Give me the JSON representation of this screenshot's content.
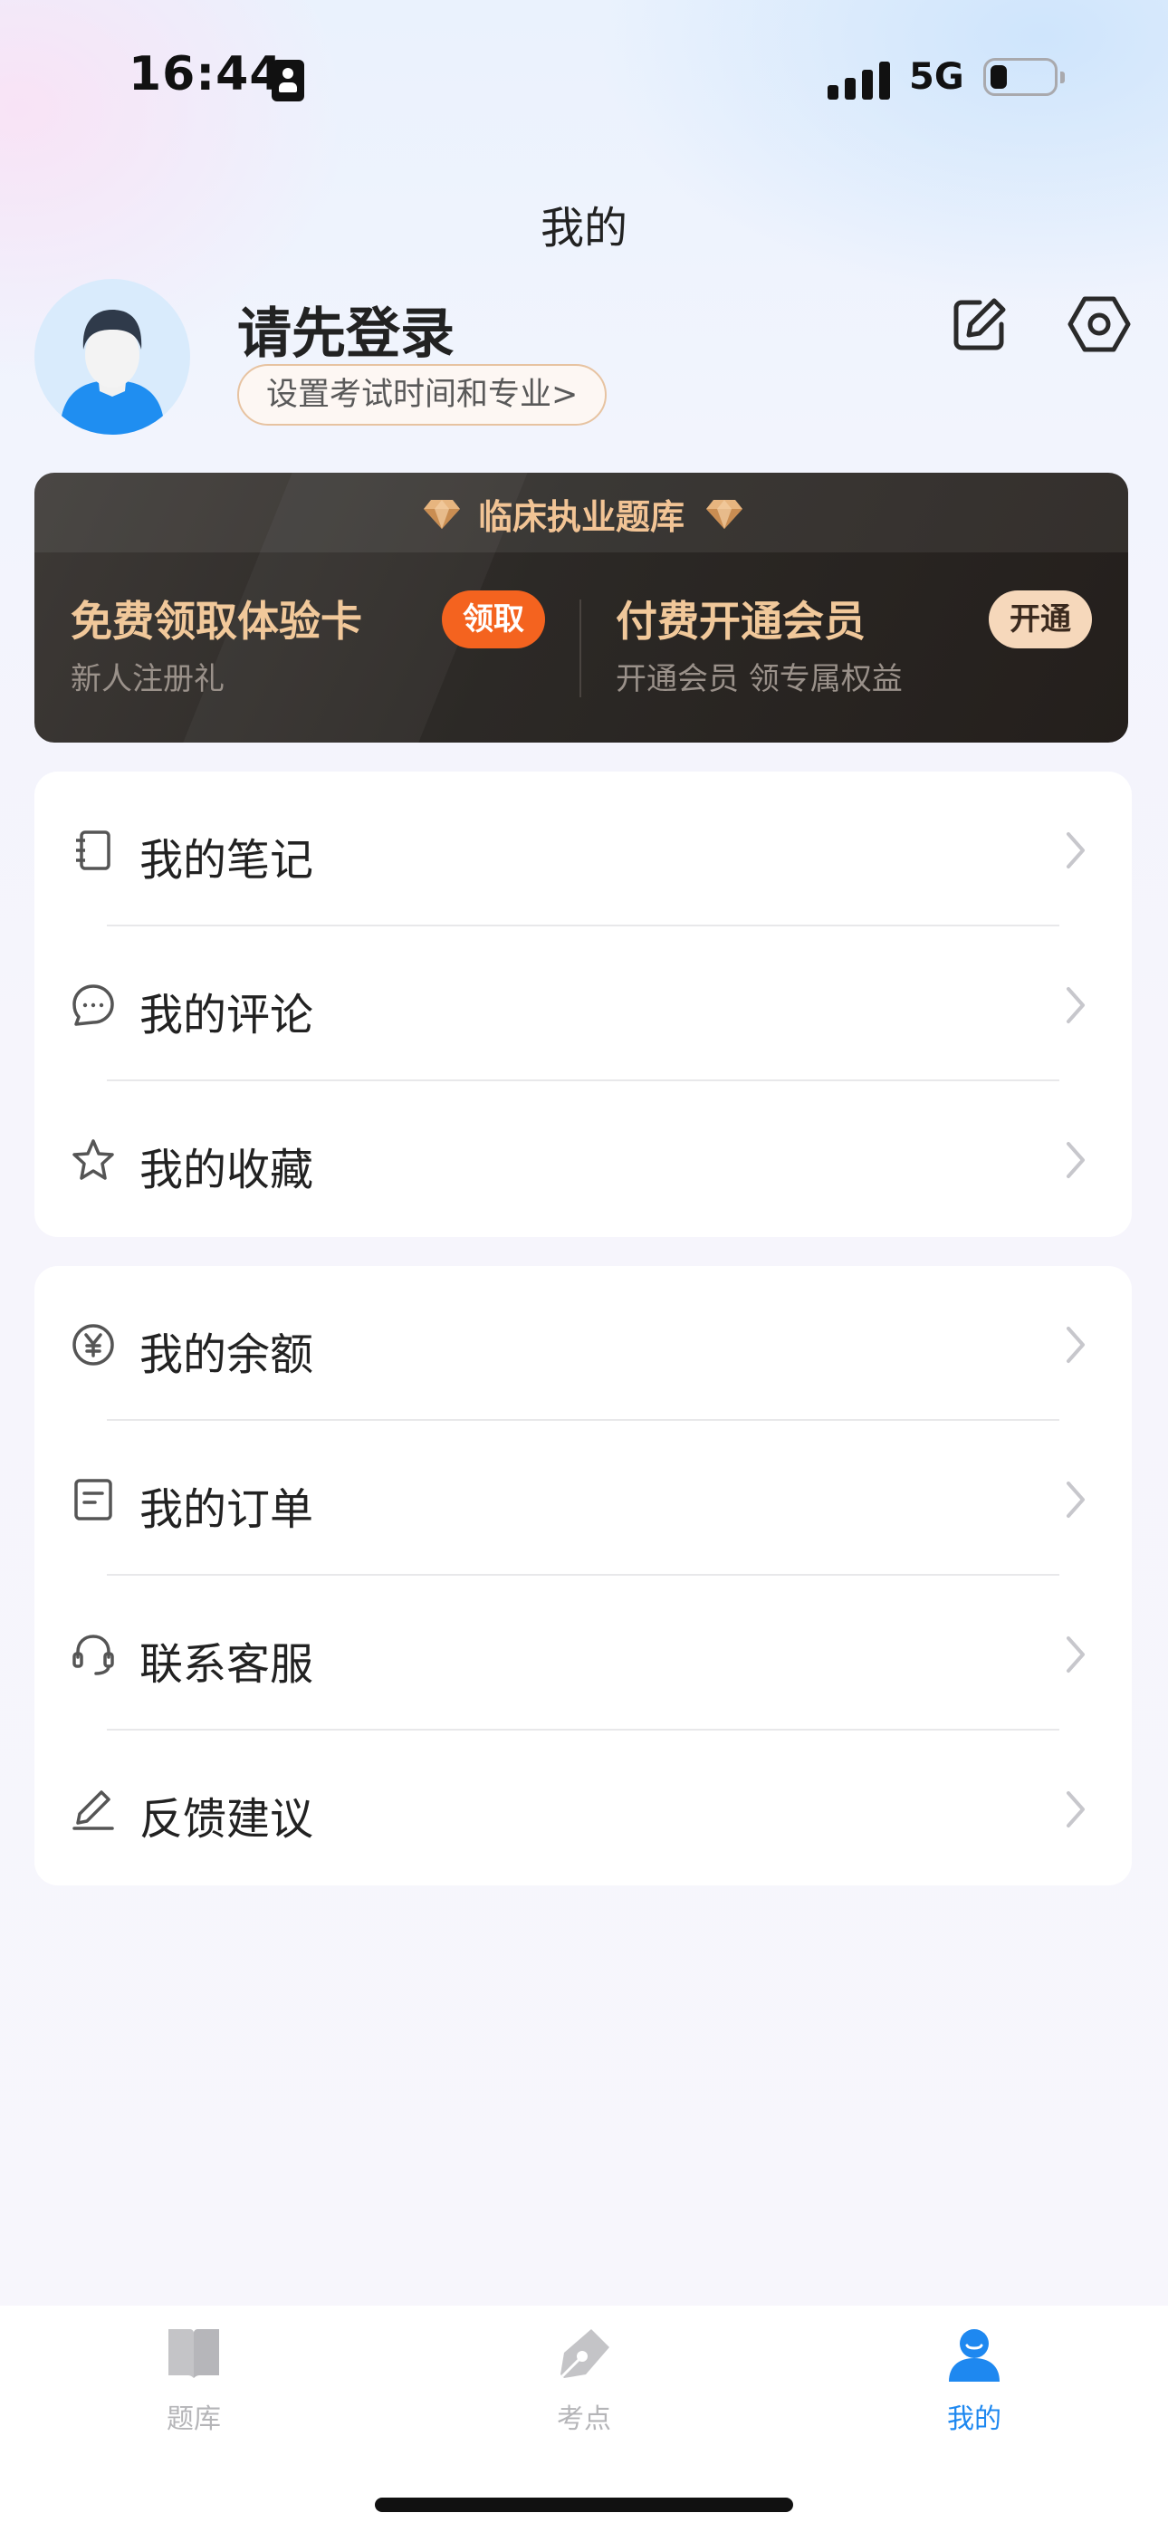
{
  "status_bar": {
    "time": "16:44",
    "network": "5G"
  },
  "header": {
    "title": "我的"
  },
  "profile": {
    "login_title": "请先登录",
    "login_subtitle": "设置考试时间和专业>",
    "edit_icon": "edit-icon",
    "settings_icon": "settings-hexagon-icon"
  },
  "vip_card": {
    "title": "临床执业题库",
    "left": {
      "title": "免费领取体验卡",
      "subtitle": "新人注册礼",
      "button": "领取"
    },
    "right": {
      "title": "付费开通会员",
      "subtitle": "开通会员 领专属权益",
      "button": "开通"
    },
    "colors": {
      "gold": "#f1c89a",
      "claim": "#f4631f",
      "open": "#f6d8bb"
    }
  },
  "menu_group_1": [
    {
      "label": "我的笔记",
      "icon": "notebook-icon"
    },
    {
      "label": "我的评论",
      "icon": "comment-icon"
    },
    {
      "label": "我的收藏",
      "icon": "star-icon"
    }
  ],
  "menu_group_2": [
    {
      "label": "我的余额",
      "icon": "yuan-coin-icon"
    },
    {
      "label": "我的订单",
      "icon": "order-list-icon"
    },
    {
      "label": "联系客服",
      "icon": "headset-icon"
    },
    {
      "label": "反馈建议",
      "icon": "pencil-icon"
    }
  ],
  "tabbar": {
    "items": [
      {
        "label": "题库",
        "icon": "book-icon",
        "active": false
      },
      {
        "label": "考点",
        "icon": "pen-nib-icon",
        "active": false
      },
      {
        "label": "我的",
        "icon": "person-icon",
        "active": true
      }
    ],
    "active_color": "#1e88f0"
  }
}
